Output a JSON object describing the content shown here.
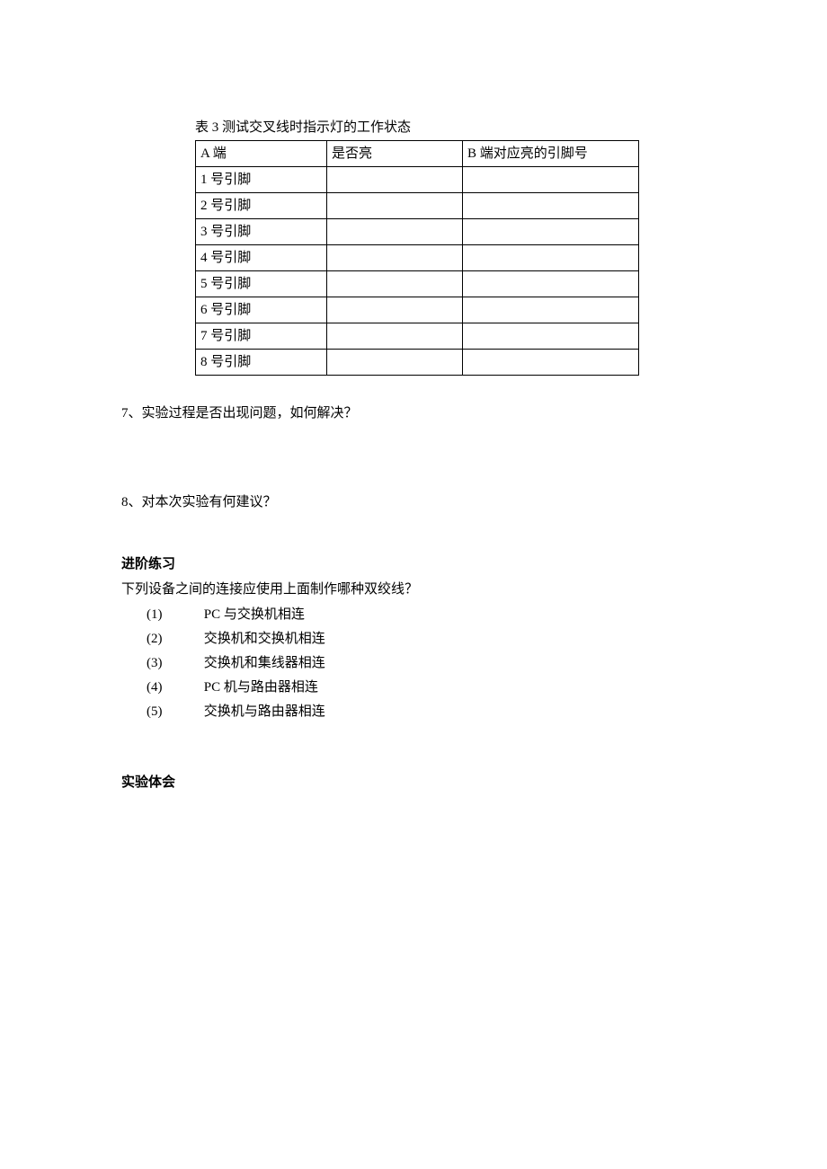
{
  "table": {
    "caption": "表 3 测试交叉线时指示灯的工作状态",
    "headers": [
      "A 端",
      "是否亮",
      "B 端对应亮的引脚号"
    ],
    "rows": [
      [
        "1 号引脚",
        "",
        ""
      ],
      [
        "2 号引脚",
        "",
        ""
      ],
      [
        "3 号引脚",
        "",
        ""
      ],
      [
        "4 号引脚",
        "",
        ""
      ],
      [
        "5 号引脚",
        "",
        ""
      ],
      [
        "6 号引脚",
        "",
        ""
      ],
      [
        "7 号引脚",
        "",
        ""
      ],
      [
        "8 号引脚",
        "",
        ""
      ]
    ]
  },
  "q7": "7、实验过程是否出现问题，如何解决？",
  "q8": "8、对本次实验有何建议？",
  "advanced": {
    "heading": "进阶练习",
    "prompt": "下列设备之间的连接应使用上面制作哪种双绞线？",
    "items": [
      {
        "num": "(1)",
        "text": "PC 与交换机相连"
      },
      {
        "num": "(2)",
        "text": "交换机和交换机相连"
      },
      {
        "num": "(3)",
        "text": "交换机和集线器相连"
      },
      {
        "num": "(4)",
        "text": "PC 机与路由器相连"
      },
      {
        "num": "(5)",
        "text": "交换机与路由器相连"
      }
    ]
  },
  "experience": "实验体会"
}
